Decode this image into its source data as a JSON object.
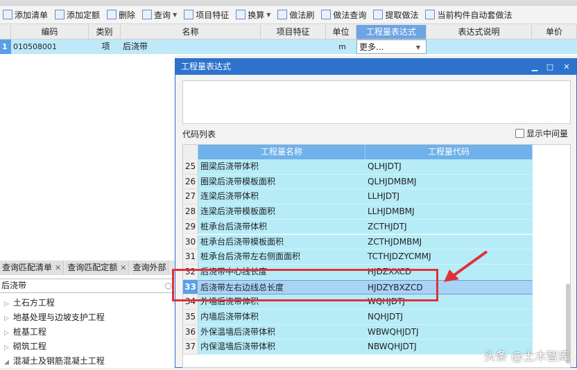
{
  "toolbar": {
    "items": [
      {
        "label": "添加清单",
        "icon": "add-list-icon"
      },
      {
        "label": "添加定额",
        "icon": "add-quota-icon"
      },
      {
        "label": "删除",
        "icon": "delete-icon"
      },
      {
        "label": "查询",
        "icon": "query-icon",
        "dropdown": true
      },
      {
        "label": "项目特征",
        "icon": "feature-icon"
      },
      {
        "label": "换算",
        "icon": "fx-icon",
        "dropdown": true
      },
      {
        "label": "做法刷",
        "icon": "brush-icon"
      },
      {
        "label": "做法查询",
        "icon": "method-query-icon"
      },
      {
        "label": "提取做法",
        "icon": "extract-icon"
      },
      {
        "label": "当前构件自动套做法",
        "icon": "auto-apply-icon"
      }
    ]
  },
  "grid": {
    "headers": [
      "编码",
      "类别",
      "名称",
      "项目特征",
      "单位",
      "工程量表达式",
      "表达式说明",
      "单价"
    ],
    "row": {
      "index": "1",
      "code": "010508001",
      "type": "项",
      "name": "后浇带",
      "unit": "m",
      "expression": "更多..."
    }
  },
  "left": {
    "tabs": [
      "查询匹配清单",
      "查询匹配定额",
      "查询外部"
    ],
    "search": "后浇带",
    "tree": [
      "土石方工程",
      "地基处理与边坡支护工程",
      "桩基工程",
      "砌筑工程",
      "混凝土及钢筋混凝土工程"
    ]
  },
  "dialog": {
    "title": "工程量表达式",
    "code_list_label": "代码列表",
    "show_intermediate": "显示中间量",
    "columns": [
      "工程量名称",
      "工程量代码"
    ],
    "selected": "33",
    "rows": [
      {
        "n": "25",
        "name": "圈梁后浇带体积",
        "code": "QLHJDTJ"
      },
      {
        "n": "26",
        "name": "圈梁后浇带模板面积",
        "code": "QLHJDMBMJ"
      },
      {
        "n": "27",
        "name": "连梁后浇带体积",
        "code": "LLHJDTJ"
      },
      {
        "n": "28",
        "name": "连梁后浇带模板面积",
        "code": "LLHJDMBMJ"
      },
      {
        "n": "29",
        "name": "桩承台后浇带体积",
        "code": "ZCTHJDTJ"
      },
      {
        "n": "30",
        "name": "桩承台后浇带模板面积",
        "code": "ZCTHJDMBMJ"
      },
      {
        "n": "31",
        "name": "桩承台后浇带左右侧面面积",
        "code": "TCTHJDZYCMMJ"
      },
      {
        "n": "32",
        "name": "后浇带中心线长度",
        "code": "HJDZXXCD"
      },
      {
        "n": "33",
        "name": "后浇带左右边线总长度",
        "code": "HJDZYBXZCD"
      },
      {
        "n": "34",
        "name": "外墙后浇带体积",
        "code": "WQHJDTJ"
      },
      {
        "n": "35",
        "name": "内墙后浇带体积",
        "code": "NQHJDTJ"
      },
      {
        "n": "36",
        "name": "外保温墙后浇带体积",
        "code": "WBWQHJDTJ"
      },
      {
        "n": "37",
        "name": "内保温墙后浇带体积",
        "code": "NBWQHJDTJ"
      }
    ]
  },
  "watermark": "头条 @土木智库",
  "colors": {
    "accent": "#2d73cc",
    "row": "#b6ecf8",
    "highlight": "#e0303a"
  }
}
